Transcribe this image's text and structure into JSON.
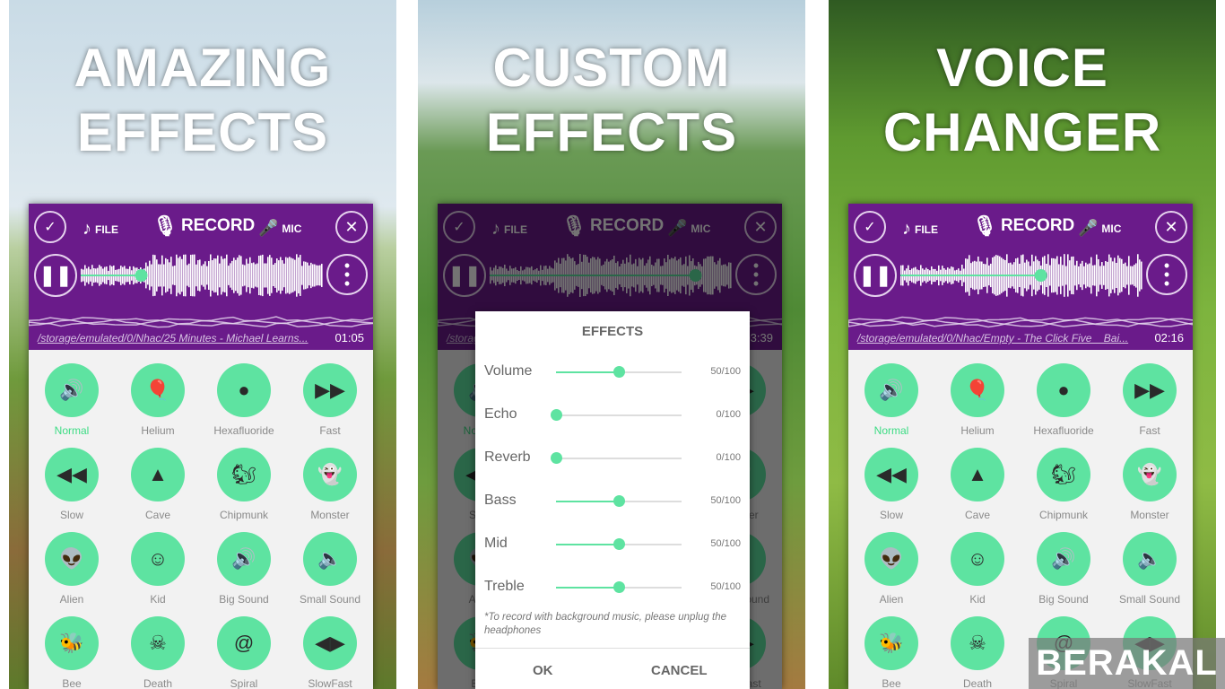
{
  "colors": {
    "toolbar": "#6a1b8a",
    "accent": "#5ee3a1",
    "selected_label": "#3ddc84"
  },
  "panels": [
    {
      "headline": [
        "AMAZING",
        "EFFECTS"
      ],
      "path": "/storage/emulated/0/Nhac/25 Minutes - Michael Learns...",
      "time": "01:05",
      "progress": 0.25
    },
    {
      "headline": [
        "CUSTOM",
        "EFFECTS"
      ],
      "path": "/storage/emulated/0/Nhac/...",
      "time": "03:39",
      "progress": 0.85
    },
    {
      "headline": [
        "VOICE",
        "CHANGER"
      ],
      "path": "/storage/emulated/0/Nhac/Empty - The Click Five _ Bai...",
      "time": "02:16",
      "progress": 0.58
    }
  ],
  "toolbar": {
    "file": "FILE",
    "record": "RECORD",
    "mic": "MIC",
    "icons": [
      "clipboard-check-icon",
      "music-note-icon",
      "microphone-icon",
      "karaoke-mic-icon",
      "tools-icon",
      "pause-icon",
      "more-vertical-icon"
    ]
  },
  "effects": [
    {
      "label": "Normal",
      "icon": "🔊",
      "selected": true
    },
    {
      "label": "Helium",
      "icon": "🎈"
    },
    {
      "label": "Hexafluoride",
      "icon": "●"
    },
    {
      "label": "Fast",
      "icon": "▶▶"
    },
    {
      "label": "Slow",
      "icon": "◀◀"
    },
    {
      "label": "Cave",
      "icon": "▲"
    },
    {
      "label": "Chipmunk",
      "icon": "🐿"
    },
    {
      "label": "Monster",
      "icon": "👻"
    },
    {
      "label": "Alien",
      "icon": "👽"
    },
    {
      "label": "Kid",
      "icon": "☺"
    },
    {
      "label": "Big Sound",
      "icon": "🔊"
    },
    {
      "label": "Small Sound",
      "icon": "🔈"
    },
    {
      "label": "Bee",
      "icon": "🐝"
    },
    {
      "label": "Death",
      "icon": "☠"
    },
    {
      "label": "Spiral",
      "icon": "@"
    },
    {
      "label": "SlowFast",
      "icon": "◀▶"
    }
  ],
  "dialog": {
    "title": "EFFECTS",
    "sliders": [
      {
        "name": "Volume",
        "value": 50,
        "max": 100,
        "text": "50/100"
      },
      {
        "name": "Echo",
        "value": 0,
        "max": 100,
        "text": "0/100"
      },
      {
        "name": "Reverb",
        "value": 0,
        "max": 100,
        "text": "0/100"
      },
      {
        "name": "Bass",
        "value": 50,
        "max": 100,
        "text": "50/100"
      },
      {
        "name": "Mid",
        "value": 50,
        "max": 100,
        "text": "50/100"
      },
      {
        "name": "Treble",
        "value": 50,
        "max": 100,
        "text": "50/100"
      }
    ],
    "note": "*To record with background music, please unplug the headphones",
    "ok": "OK",
    "cancel": "CANCEL"
  },
  "watermark": "BERAKAL"
}
